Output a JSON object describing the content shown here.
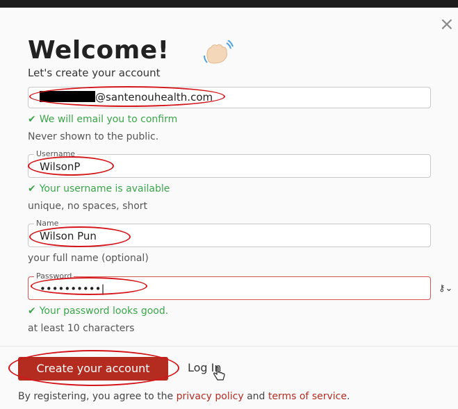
{
  "modal": {
    "title": "Welcome!",
    "subtitle": "Let's create your account",
    "close_glyph": "×"
  },
  "email": {
    "value_suffix": "@santenouhealth.com",
    "status": "We will email you to confirm",
    "hint": "Never shown to the public."
  },
  "username": {
    "label": "Username",
    "value": "WilsonP",
    "status": "Your username is available",
    "hint": "unique, no spaces, short"
  },
  "name": {
    "label": "Name",
    "value": "Wilson Pun",
    "hint": "your full name (optional)"
  },
  "password": {
    "label": "Password",
    "value": "••••••••••",
    "status": "Your password looks good.",
    "hint": "at least 10 characters"
  },
  "actions": {
    "create_label": "Create your account",
    "login_label": "Log In"
  },
  "footer": {
    "prefix": "By registering, you agree to the ",
    "privacy_label": "privacy policy",
    "middle": " and ",
    "terms_label": "terms of service",
    "suffix": "."
  },
  "icons": {
    "check": "check-icon",
    "key": "key-icon",
    "wave": "waving-hand-icon",
    "pointer": "pointer-hand-icon"
  },
  "colors": {
    "brand": "#b42c20",
    "success": "#3aa54a",
    "annotation": "#d4151a"
  }
}
